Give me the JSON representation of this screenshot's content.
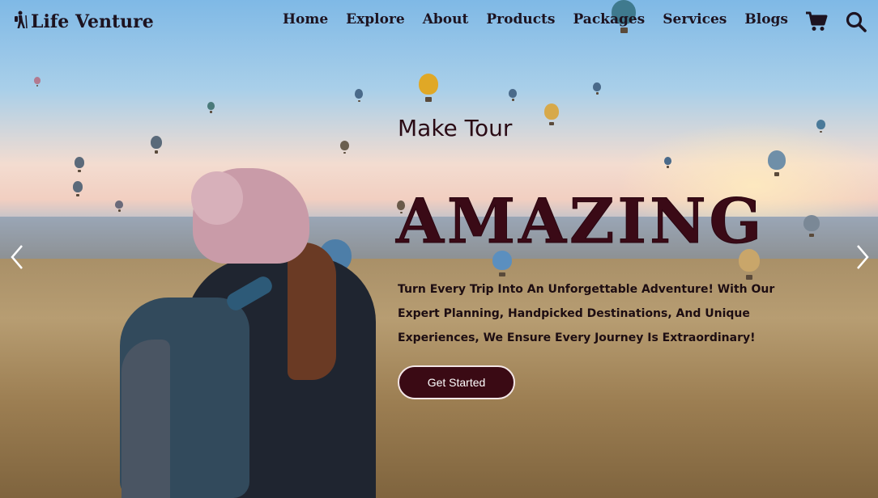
{
  "brand": {
    "name": "Life Venture",
    "icon": "hiker-icon"
  },
  "nav": {
    "items": [
      {
        "label": "Home"
      },
      {
        "label": "Explore"
      },
      {
        "label": "About"
      },
      {
        "label": "Products"
      },
      {
        "label": "Packages"
      },
      {
        "label": "Services"
      },
      {
        "label": "Blogs"
      }
    ],
    "cart_icon": "cart-icon",
    "search_icon": "search-icon"
  },
  "hero": {
    "subtitle": "Make Tour",
    "headline": "AMAZING",
    "description": "Turn Every Trip Into An Unforgettable Adventure! With Our Expert Planning, Handpicked Destinations, And Unique Experiences, We Ensure Every Journey Is Extraordinary!",
    "cta_label": "Get Started",
    "prev_icon": "chevron-left-icon",
    "next_icon": "chevron-right-icon"
  },
  "colors": {
    "text_dark": "#1d1320",
    "accent": "#3a0a14",
    "button_border": "#f3e6e6"
  }
}
